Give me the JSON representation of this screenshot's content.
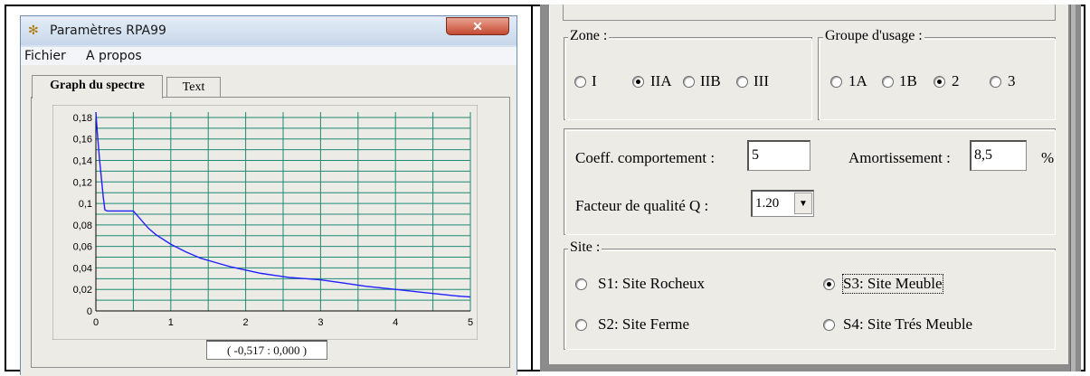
{
  "left_window": {
    "title": "Paramètres RPA99",
    "close_glyph": "✕",
    "app_icon": "gear-icon",
    "menu": [
      "Fichier",
      "A propos"
    ],
    "tabs": [
      {
        "label": "Graph du spectre",
        "active": true
      },
      {
        "label": "Text",
        "active": false
      }
    ],
    "status": "( -0,517 : 0,000 )"
  },
  "chart_data": {
    "type": "line",
    "x_ticks": [
      "0",
      "1",
      "2",
      "3",
      "4",
      "5"
    ],
    "y_ticks": [
      "0",
      "0,02",
      "0,04",
      "0,06",
      "0,08",
      "0,1",
      "0,12",
      "0,14",
      "0,16",
      "0,18"
    ],
    "xlim": [
      0,
      5
    ],
    "ylim": [
      0,
      0.185
    ],
    "grid": true,
    "line_color": "#2020ff",
    "grid_color": "#1f8a73",
    "series": [
      {
        "x": [
          0,
          0.02,
          0.05,
          0.1,
          0.12,
          0.15,
          0.5,
          0.6,
          0.7,
          0.8,
          1.0,
          1.2,
          1.4,
          1.6,
          1.8,
          2.0,
          2.2,
          2.4,
          2.6,
          2.8,
          3.0,
          3.3,
          3.6,
          4.0,
          4.4,
          4.8,
          5.0
        ],
        "y": [
          0.185,
          0.165,
          0.14,
          0.105,
          0.094,
          0.093,
          0.093,
          0.085,
          0.077,
          0.071,
          0.062,
          0.055,
          0.049,
          0.045,
          0.041,
          0.038,
          0.035,
          0.033,
          0.031,
          0.03,
          0.029,
          0.026,
          0.023,
          0.02,
          0.017,
          0.014,
          0.013
        ]
      }
    ]
  },
  "right_window": {
    "zone": {
      "label": "Zone :",
      "options": [
        {
          "label": "I",
          "checked": false
        },
        {
          "label": "IIA",
          "checked": true
        },
        {
          "label": "IIB",
          "checked": false
        },
        {
          "label": "III",
          "checked": false
        }
      ]
    },
    "groupe": {
      "label": "Groupe d'usage :",
      "options": [
        {
          "label": "1A",
          "checked": false
        },
        {
          "label": "1B",
          "checked": false
        },
        {
          "label": "2",
          "checked": true
        },
        {
          "label": "3",
          "checked": false
        }
      ]
    },
    "coeff": {
      "label": "Coeff. comportement :",
      "value": "5"
    },
    "amort": {
      "label": "Amortissement :",
      "value": "8,5",
      "unit": "%"
    },
    "facteur": {
      "label": "Facteur de qualité Q :",
      "value": "1.20",
      "arrow": "▼"
    },
    "site": {
      "label": "Site :",
      "options": [
        {
          "label": "S1: Site Rocheux",
          "checked": false
        },
        {
          "label": "S3: Site Meuble",
          "checked": true
        },
        {
          "label": "S2: Site Ferme",
          "checked": false
        },
        {
          "label": "S4: Site Trés Meuble",
          "checked": false
        }
      ]
    }
  }
}
